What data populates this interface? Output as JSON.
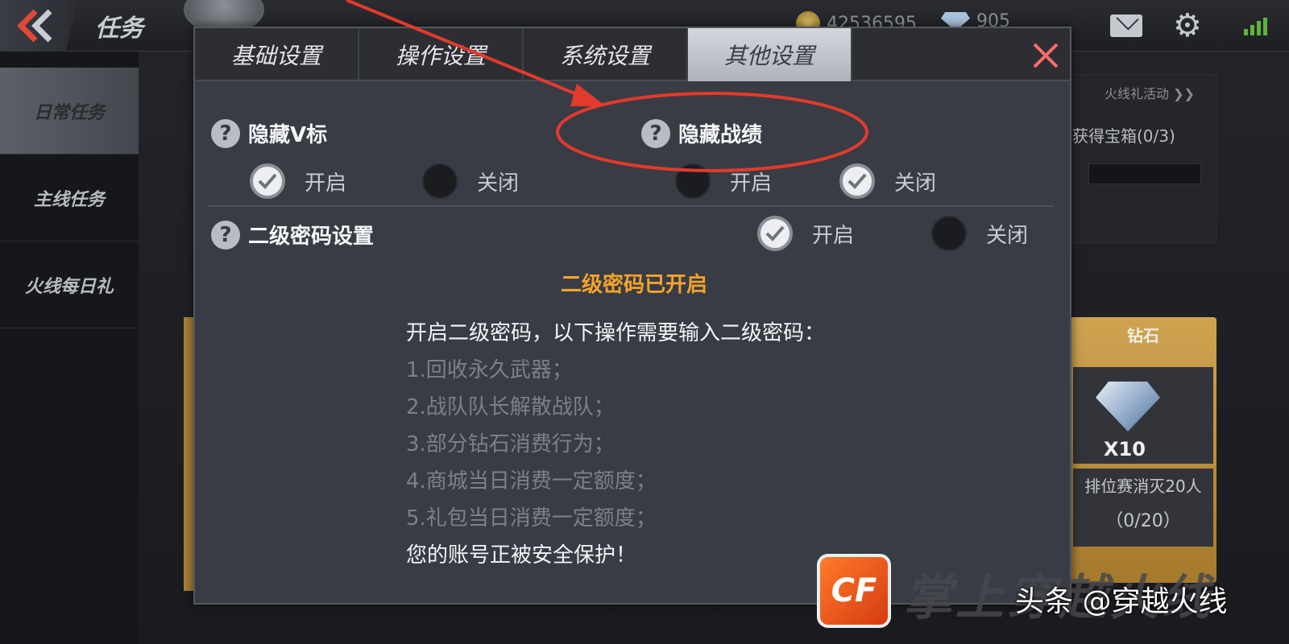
{
  "topbar": {
    "title": "任务",
    "coins": "42536595",
    "gems": "905"
  },
  "left_nav": [
    {
      "label": "日常任务",
      "active": true
    },
    {
      "label": "主线任务",
      "active": false
    },
    {
      "label": "火线每日礼",
      "active": false
    }
  ],
  "background": {
    "activity_link": "火线礼活动 ❯❯",
    "chest_progress": "获得宝箱(0/3)",
    "reward": {
      "header": "钻石",
      "count": "X10",
      "description": "排位赛消灭20人",
      "progress": "（0/20）"
    }
  },
  "dialog": {
    "tabs": [
      {
        "label": "基础设置",
        "active": false
      },
      {
        "label": "操作设置",
        "active": false
      },
      {
        "label": "系统设置",
        "active": false
      },
      {
        "label": "其他设置",
        "active": true
      }
    ],
    "hide_v": {
      "label": "隐藏V标",
      "on_label": "开启",
      "off_label": "关闭",
      "selected": "on"
    },
    "hide_record": {
      "label": "隐藏战绩",
      "on_label": "开启",
      "off_label": "关闭",
      "selected": "off"
    },
    "secondary_password": {
      "label": "二级密码设置",
      "on_label": "开启",
      "off_label": "关闭",
      "selected": "on",
      "status": "二级密码已开启",
      "lead": "开启二级密码，以下操作需要输入二级密码：",
      "items": [
        "1.回收永久武器；",
        "2.战队队长解散战队；",
        "3.部分钻石消费行为；",
        "4.商城当日消费一定额度；",
        "5.礼包当日消费一定额度；"
      ],
      "footer": "您的账号正被安全保护！"
    }
  },
  "watermark": {
    "logo_text": "CF",
    "title": "掌上穿越火线",
    "credit": "头条 @穿越火线"
  },
  "colors": {
    "status_orange": "#f2a42c",
    "annotation_red": "#e23a2c",
    "dialog_bg": "#393c44"
  }
}
